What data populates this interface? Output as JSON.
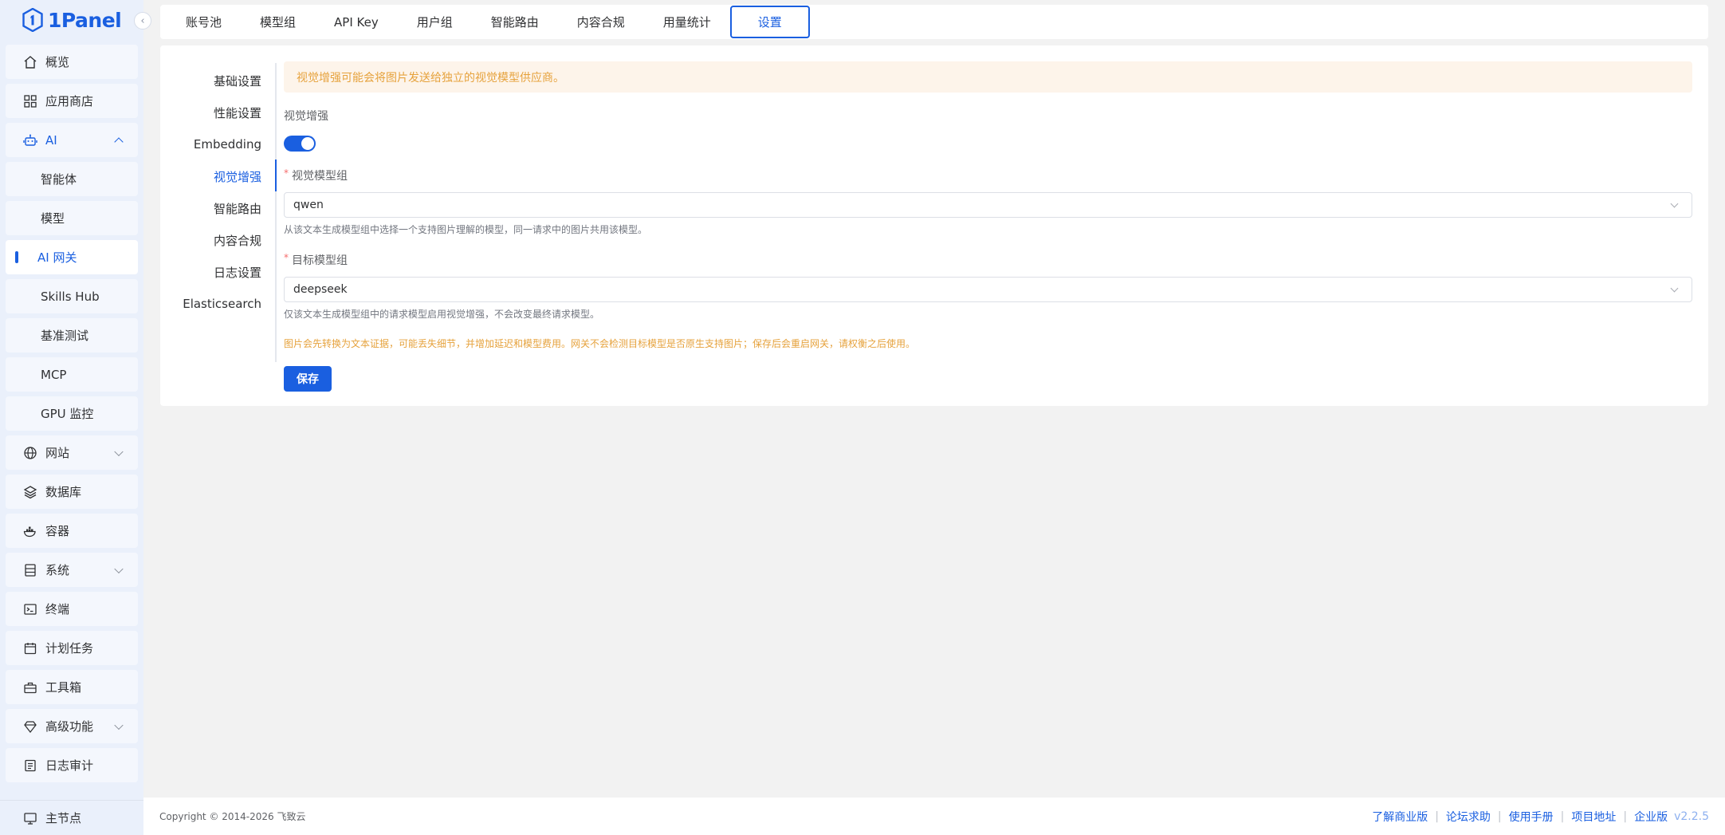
{
  "app": {
    "logo_text": "1Panel"
  },
  "sidebar": {
    "items": [
      {
        "label": "概览",
        "icon": "home-icon"
      },
      {
        "label": "应用商店",
        "icon": "apps-grid-icon"
      },
      {
        "label": "AI",
        "icon": "robot-icon",
        "expanded": true
      },
      {
        "label": "智能体"
      },
      {
        "label": "模型"
      },
      {
        "label": "AI 网关",
        "active": true
      },
      {
        "label": "Skills Hub"
      },
      {
        "label": "基准测试"
      },
      {
        "label": "MCP"
      },
      {
        "label": "GPU 监控"
      },
      {
        "label": "网站",
        "icon": "globe-icon"
      },
      {
        "label": "数据库",
        "icon": "layers-icon"
      },
      {
        "label": "容器",
        "icon": "docker-icon"
      },
      {
        "label": "系统",
        "icon": "server-icon"
      },
      {
        "label": "终端",
        "icon": "terminal-icon"
      },
      {
        "label": "计划任务",
        "icon": "calendar-icon"
      },
      {
        "label": "工具箱",
        "icon": "toolbox-icon"
      },
      {
        "label": "高级功能",
        "icon": "diamond-icon"
      },
      {
        "label": "日志审计",
        "icon": "log-icon"
      }
    ],
    "bottom": {
      "label": "主节点",
      "icon": "node-icon"
    }
  },
  "tabs": [
    {
      "label": "账号池"
    },
    {
      "label": "模型组"
    },
    {
      "label": "API Key"
    },
    {
      "label": "用户组"
    },
    {
      "label": "智能路由"
    },
    {
      "label": "内容合规"
    },
    {
      "label": "用量统计"
    },
    {
      "label": "设置",
      "active": true
    }
  ],
  "settings_nav": [
    {
      "label": "基础设置"
    },
    {
      "label": "性能设置"
    },
    {
      "label": "Embedding"
    },
    {
      "label": "视觉增强",
      "active": true
    },
    {
      "label": "智能路由"
    },
    {
      "label": "内容合规"
    },
    {
      "label": "日志设置"
    },
    {
      "label": "Elasticsearch"
    }
  ],
  "form": {
    "alert": "视觉增强可能会将图片发送给独立的视觉模型供应商。",
    "toggle_label": "视觉增强",
    "toggle_on": true,
    "vision_group_label": "视觉模型组",
    "vision_group_value": "qwen",
    "vision_group_help": "从该文本生成模型组中选择一个支持图片理解的模型，同一请求中的图片共用该模型。",
    "target_group_label": "目标模型组",
    "target_group_value": "deepseek",
    "target_group_help": "仅该文本生成模型组中的请求模型启用视觉增强，不会改变最终请求模型。",
    "warning": "图片会先转换为文本证据，可能丢失细节，并增加延迟和模型费用。网关不会检测目标模型是否原生支持图片；保存后会重启网关，请权衡之后使用。",
    "save_label": "保存"
  },
  "footer": {
    "copyright": "Copyright © 2014-2026 飞致云",
    "links": [
      "了解商业版",
      "论坛求助",
      "使用手册",
      "项目地址",
      "企业版"
    ],
    "version": "v2.2.5"
  },
  "colors": {
    "accent": "#1a5fe0",
    "warning": "#e6a23c",
    "sidebar_bg": "#eaf0fb"
  }
}
